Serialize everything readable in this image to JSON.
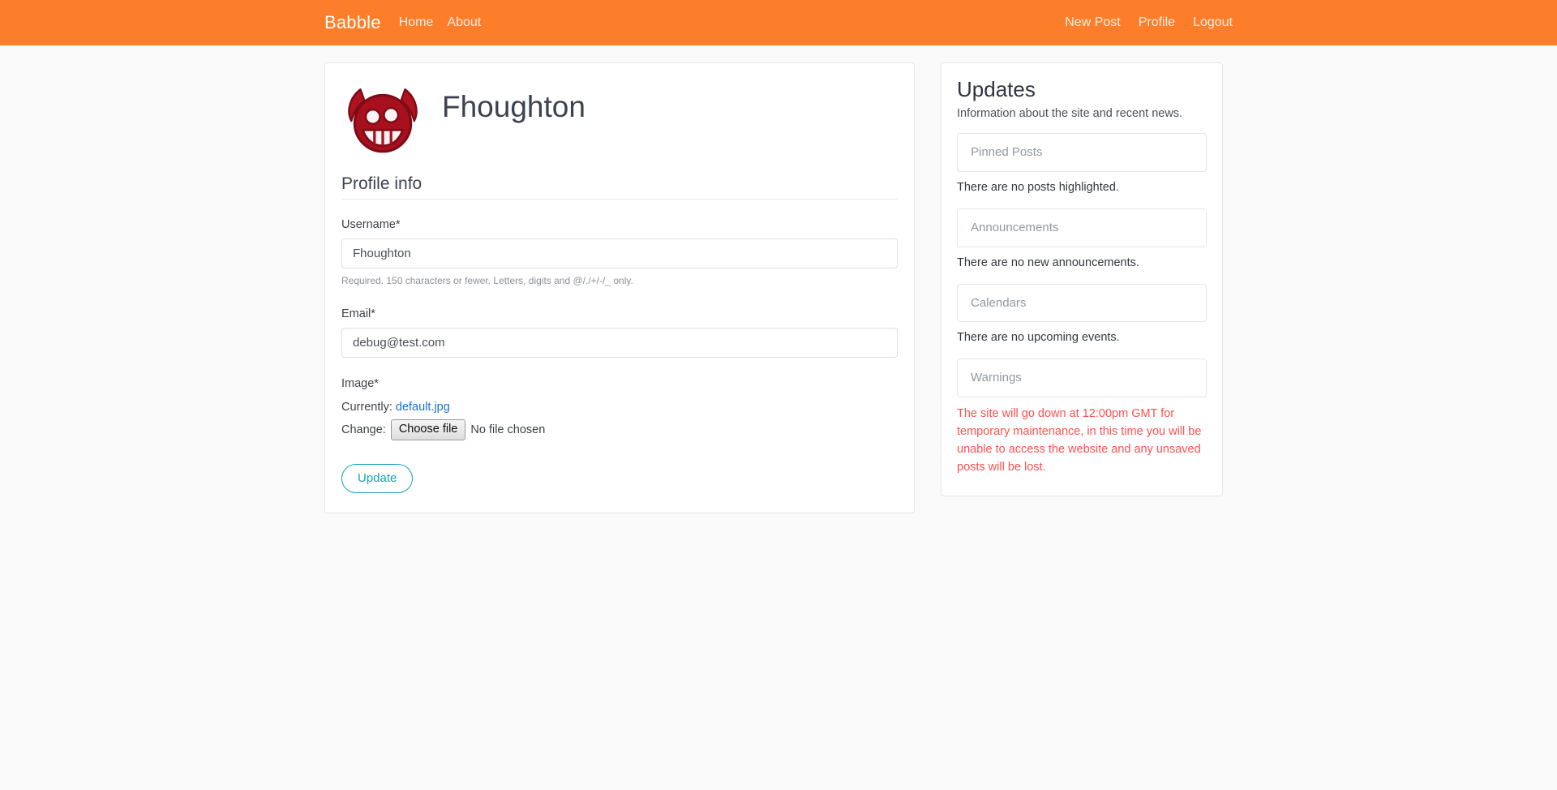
{
  "navbar": {
    "brand": "Babble",
    "left_links": [
      {
        "label": "Home",
        "name": "nav-link-home"
      },
      {
        "label": "About",
        "name": "nav-link-about"
      }
    ],
    "right_links": [
      {
        "label": "New Post",
        "name": "nav-link-new-post"
      },
      {
        "label": "Profile",
        "name": "nav-link-profile"
      },
      {
        "label": "Logout",
        "name": "nav-link-logout"
      }
    ],
    "background_color": "#fd7e2a",
    "text_color": "#ffffff"
  },
  "profile": {
    "username_heading": "Fhoughton",
    "avatar_icon": "devil-face-icon",
    "section_title": "Profile info",
    "fields": {
      "username": {
        "label": "Username*",
        "value": "Fhoughton",
        "placeholder": "Username",
        "help": "Required. 150 characters or fewer. Letters, digits and @/./+/-/_ only."
      },
      "email": {
        "label": "Email*",
        "value": "debug@test.com",
        "placeholder": "Email"
      },
      "image": {
        "label": "Image*",
        "currently_label": "Currently:",
        "currently_file": "default.jpg",
        "change_label": "Change:",
        "choose_file_button": "Choose file",
        "no_file_text": "No file chosen"
      }
    },
    "submit_button": "Update",
    "submit_color": "#17a2b8"
  },
  "sidebar": {
    "title": "Updates",
    "subtitle": "Information about the site and recent news.",
    "sections": [
      {
        "header": "Pinned Posts",
        "body": "There are no posts highlighted.",
        "is_warning": false
      },
      {
        "header": "Announcements",
        "body": "There are no new announcements.",
        "is_warning": false
      },
      {
        "header": "Calendars",
        "body": "There are no upcoming events.",
        "is_warning": false
      },
      {
        "header": "Warnings",
        "body": "The site will go down at 12:00pm GMT for temporary maintenance, in this time you will be unable to access the website and any unsaved posts will be lost.",
        "is_warning": true
      }
    ],
    "warning_color": "#ff4f4f"
  }
}
